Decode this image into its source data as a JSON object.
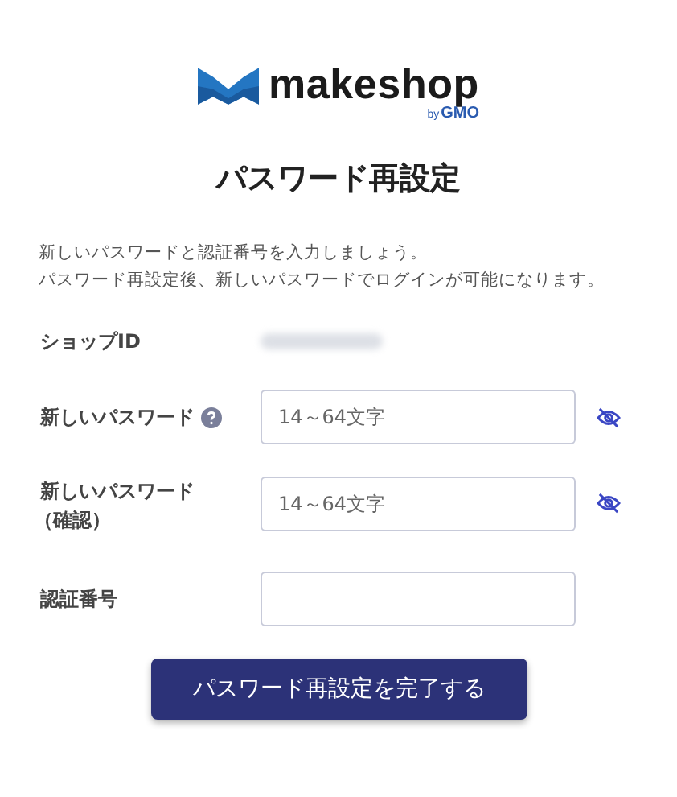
{
  "logo": {
    "wordmark": "makeshop",
    "by": "by",
    "company": "GMO"
  },
  "title": "パスワード再設定",
  "intro": [
    "新しいパスワードと認証番号を入力しましょう。",
    "パスワード再設定後、新しいパスワードでログインが可能になります。"
  ],
  "rows": [
    {
      "kind": "masked",
      "label": "ショップID"
    },
    {
      "kind": "input",
      "label": "新しいパスワード",
      "help": true,
      "placeholder": "14～64文字",
      "reveal_toggle": true
    },
    {
      "kind": "input",
      "label": "新しいパスワード",
      "sublabel": "（確認）",
      "help": false,
      "placeholder": "14～64文字",
      "reveal_toggle": true
    },
    {
      "kind": "input",
      "label": "認証番号",
      "help": false,
      "reveal_toggle": false
    }
  ],
  "submit": "パスワード再設定を完了する"
}
